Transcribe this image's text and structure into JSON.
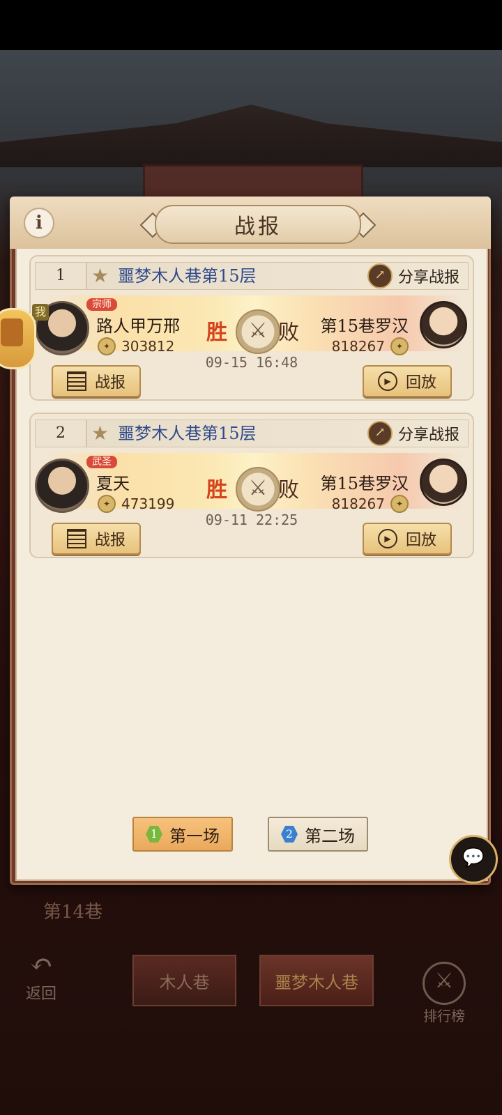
{
  "panel": {
    "title": "战报",
    "info_icon": "i"
  },
  "battles": [
    {
      "index": "1",
      "title": "噩梦木人巷第15层",
      "share_label": "分享战报",
      "player": {
        "me_badge": "我",
        "rank": "宗师",
        "name": "路人甲万邢",
        "power": "303812"
      },
      "win_label": "胜",
      "lose_label": "败",
      "opponent": {
        "name": "第15巷罗汉",
        "power": "818267"
      },
      "time": "09-15 16:48",
      "report_label": "战报",
      "replay_label": "回放"
    },
    {
      "index": "2",
      "title": "噩梦木人巷第15层",
      "share_label": "分享战报",
      "player": {
        "rank": "武圣",
        "name": "夏天",
        "power": "473199"
      },
      "win_label": "胜",
      "lose_label": "败",
      "opponent": {
        "name": "第15巷罗汉",
        "power": "818267"
      },
      "time": "09-11 22:25",
      "report_label": "战报",
      "replay_label": "回放"
    }
  ],
  "match_tabs": [
    {
      "num": "1",
      "label": "第一场",
      "selected": true
    },
    {
      "num": "2",
      "label": "第二场",
      "selected": false
    }
  ],
  "background": {
    "floor_label": "第14巷",
    "tabs": [
      "木人巷",
      "噩梦木人巷"
    ],
    "back_label": "返回",
    "rank_label": "排行榜"
  },
  "colors": {
    "title_blue": "#2f4a8c",
    "win_red": "#d6441d",
    "rank_tag_red": "#d94a3b",
    "tab_one_green": "#79b83d",
    "tab_two_blue": "#3a7fd0"
  }
}
